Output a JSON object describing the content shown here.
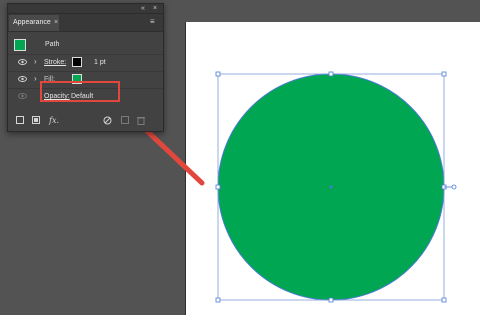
{
  "panel": {
    "title": "Appearance",
    "close_glyph": "×",
    "collapse_glyph": "«",
    "close_panel_glyph": "×",
    "menu_glyph": "≡",
    "object_type": "Path",
    "rows": [
      {
        "label": "Stroke:",
        "value": "1 pt",
        "swatch_color": "#000000"
      },
      {
        "label": "Fill:",
        "swatch_color": "#00a651"
      },
      {
        "label": "Opacity:",
        "value": "Default"
      }
    ],
    "bottom_icons": [
      "new-stroke-icon",
      "new-fill-icon",
      "fx-icon",
      "clear-appearance-icon",
      "duplicate-item-icon",
      "delete-item-icon"
    ],
    "fx_label": "fx."
  },
  "canvas": {
    "shape": "ellipse",
    "fill_color": "#00a651",
    "selection_color": "#4a7bd4",
    "annotation_color": "#e2473d"
  }
}
